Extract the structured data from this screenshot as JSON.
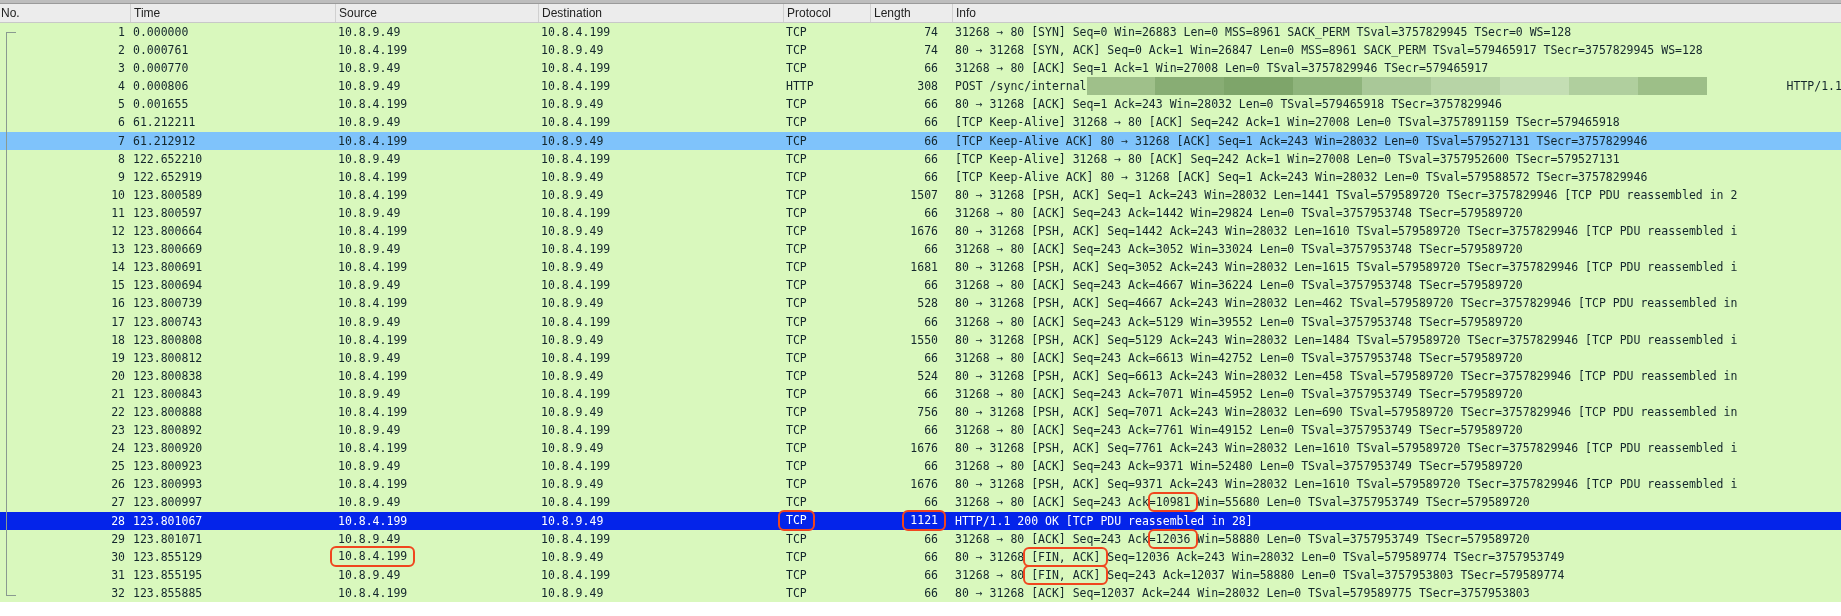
{
  "columns": [
    "No.",
    "Time",
    "Source",
    "Destination",
    "Protocol",
    "Length",
    "Info"
  ],
  "packets": [
    {
      "no": "1",
      "time": "0.000000",
      "source": "10.8.9.49",
      "destination": "10.8.4.199",
      "protocol": "TCP",
      "length": "74",
      "info": "31268 → 80 [SYN] Seq=0 Win=26883 Len=0 MSS=8961 SACK_PERM TSval=3757829945 TSecr=0 WS=128",
      "selected": false,
      "related": false,
      "redacted": false
    },
    {
      "no": "2",
      "time": "0.000761",
      "source": "10.8.4.199",
      "destination": "10.8.9.49",
      "protocol": "TCP",
      "length": "74",
      "info": "80 → 31268 [SYN, ACK] Seq=0 Ack=1 Win=26847 Len=0 MSS=8961 SACK_PERM TSval=579465917 TSecr=3757829945 WS=128",
      "selected": false,
      "related": false,
      "redacted": false
    },
    {
      "no": "3",
      "time": "0.000770",
      "source": "10.8.9.49",
      "destination": "10.8.4.199",
      "protocol": "TCP",
      "length": "66",
      "info": "31268 → 80 [ACK] Seq=1 Ack=1 Win=27008 Len=0 TSval=3757829946 TSecr=579465917",
      "selected": false,
      "related": false,
      "redacted": false
    },
    {
      "no": "4",
      "time": "0.000806",
      "source": "10.8.9.49",
      "destination": "10.8.4.199",
      "protocol": "HTTP",
      "length": "308",
      "info": "POST /sync/internal",
      "info_end": "HTTP/1.1",
      "selected": false,
      "related": false,
      "redacted": true
    },
    {
      "no": "5",
      "time": "0.001655",
      "source": "10.8.4.199",
      "destination": "10.8.9.49",
      "protocol": "TCP",
      "length": "66",
      "info": "80 → 31268 [ACK] Seq=1 Ack=243 Win=28032 Len=0 TSval=579465918 TSecr=3757829946",
      "selected": false,
      "related": false,
      "redacted": false
    },
    {
      "no": "6",
      "time": "61.212211",
      "source": "10.8.9.49",
      "destination": "10.8.4.199",
      "protocol": "TCP",
      "length": "66",
      "info": "[TCP Keep-Alive] 31268 → 80 [ACK] Seq=242 Ack=1 Win=27008 Len=0 TSval=3757891159 TSecr=579465918",
      "selected": false,
      "related": false,
      "redacted": false
    },
    {
      "no": "7",
      "time": "61.212912",
      "source": "10.8.4.199",
      "destination": "10.8.9.49",
      "protocol": "TCP",
      "length": "66",
      "info": "[TCP Keep-Alive ACK] 80 → 31268 [ACK] Seq=1 Ack=243 Win=28032 Len=0 TSval=579527131 TSecr=3757829946",
      "selected": false,
      "related": true,
      "redacted": false
    },
    {
      "no": "8",
      "time": "122.652210",
      "source": "10.8.9.49",
      "destination": "10.8.4.199",
      "protocol": "TCP",
      "length": "66",
      "info": "[TCP Keep-Alive] 31268 → 80 [ACK] Seq=242 Ack=1 Win=27008 Len=0 TSval=3757952600 TSecr=579527131",
      "selected": false,
      "related": false,
      "redacted": false
    },
    {
      "no": "9",
      "time": "122.652919",
      "source": "10.8.4.199",
      "destination": "10.8.9.49",
      "protocol": "TCP",
      "length": "66",
      "info": "[TCP Keep-Alive ACK] 80 → 31268 [ACK] Seq=1 Ack=243 Win=28032 Len=0 TSval=579588572 TSecr=3757829946",
      "selected": false,
      "related": false,
      "redacted": false
    },
    {
      "no": "10",
      "time": "123.800589",
      "source": "10.8.4.199",
      "destination": "10.8.9.49",
      "protocol": "TCP",
      "length": "1507",
      "info": "80 → 31268 [PSH, ACK] Seq=1 Ack=243 Win=28032 Len=1441 TSval=579589720 TSecr=3757829946 [TCP PDU reassembled in 2",
      "selected": false,
      "related": false,
      "redacted": false
    },
    {
      "no": "11",
      "time": "123.800597",
      "source": "10.8.9.49",
      "destination": "10.8.4.199",
      "protocol": "TCP",
      "length": "66",
      "info": "31268 → 80 [ACK] Seq=243 Ack=1442 Win=29824 Len=0 TSval=3757953748 TSecr=579589720",
      "selected": false,
      "related": false,
      "redacted": false
    },
    {
      "no": "12",
      "time": "123.800664",
      "source": "10.8.4.199",
      "destination": "10.8.9.49",
      "protocol": "TCP",
      "length": "1676",
      "info": "80 → 31268 [PSH, ACK] Seq=1442 Ack=243 Win=28032 Len=1610 TSval=579589720 TSecr=3757829946 [TCP PDU reassembled i",
      "selected": false,
      "related": false,
      "redacted": false
    },
    {
      "no": "13",
      "time": "123.800669",
      "source": "10.8.9.49",
      "destination": "10.8.4.199",
      "protocol": "TCP",
      "length": "66",
      "info": "31268 → 80 [ACK] Seq=243 Ack=3052 Win=33024 Len=0 TSval=3757953748 TSecr=579589720",
      "selected": false,
      "related": false,
      "redacted": false
    },
    {
      "no": "14",
      "time": "123.800691",
      "source": "10.8.4.199",
      "destination": "10.8.9.49",
      "protocol": "TCP",
      "length": "1681",
      "info": "80 → 31268 [PSH, ACK] Seq=3052 Ack=243 Win=28032 Len=1615 TSval=579589720 TSecr=3757829946 [TCP PDU reassembled i",
      "selected": false,
      "related": false,
      "redacted": false
    },
    {
      "no": "15",
      "time": "123.800694",
      "source": "10.8.9.49",
      "destination": "10.8.4.199",
      "protocol": "TCP",
      "length": "66",
      "info": "31268 → 80 [ACK] Seq=243 Ack=4667 Win=36224 Len=0 TSval=3757953748 TSecr=579589720",
      "selected": false,
      "related": false,
      "redacted": false
    },
    {
      "no": "16",
      "time": "123.800739",
      "source": "10.8.4.199",
      "destination": "10.8.9.49",
      "protocol": "TCP",
      "length": "528",
      "info": "80 → 31268 [PSH, ACK] Seq=4667 Ack=243 Win=28032 Len=462 TSval=579589720 TSecr=3757829946 [TCP PDU reassembled in",
      "selected": false,
      "related": false,
      "redacted": false
    },
    {
      "no": "17",
      "time": "123.800743",
      "source": "10.8.9.49",
      "destination": "10.8.4.199",
      "protocol": "TCP",
      "length": "66",
      "info": "31268 → 80 [ACK] Seq=243 Ack=5129 Win=39552 Len=0 TSval=3757953748 TSecr=579589720",
      "selected": false,
      "related": false,
      "redacted": false
    },
    {
      "no": "18",
      "time": "123.800808",
      "source": "10.8.4.199",
      "destination": "10.8.9.49",
      "protocol": "TCP",
      "length": "1550",
      "info": "80 → 31268 [PSH, ACK] Seq=5129 Ack=243 Win=28032 Len=1484 TSval=579589720 TSecr=3757829946 [TCP PDU reassembled i",
      "selected": false,
      "related": false,
      "redacted": false
    },
    {
      "no": "19",
      "time": "123.800812",
      "source": "10.8.9.49",
      "destination": "10.8.4.199",
      "protocol": "TCP",
      "length": "66",
      "info": "31268 → 80 [ACK] Seq=243 Ack=6613 Win=42752 Len=0 TSval=3757953748 TSecr=579589720",
      "selected": false,
      "related": false,
      "redacted": false
    },
    {
      "no": "20",
      "time": "123.800838",
      "source": "10.8.4.199",
      "destination": "10.8.9.49",
      "protocol": "TCP",
      "length": "524",
      "info": "80 → 31268 [PSH, ACK] Seq=6613 Ack=243 Win=28032 Len=458 TSval=579589720 TSecr=3757829946 [TCP PDU reassembled in",
      "selected": false,
      "related": false,
      "redacted": false
    },
    {
      "no": "21",
      "time": "123.800843",
      "source": "10.8.9.49",
      "destination": "10.8.4.199",
      "protocol": "TCP",
      "length": "66",
      "info": "31268 → 80 [ACK] Seq=243 Ack=7071 Win=45952 Len=0 TSval=3757953749 TSecr=579589720",
      "selected": false,
      "related": false,
      "redacted": false
    },
    {
      "no": "22",
      "time": "123.800888",
      "source": "10.8.4.199",
      "destination": "10.8.9.49",
      "protocol": "TCP",
      "length": "756",
      "info": "80 → 31268 [PSH, ACK] Seq=7071 Ack=243 Win=28032 Len=690 TSval=579589720 TSecr=3757829946 [TCP PDU reassembled in",
      "selected": false,
      "related": false,
      "redacted": false
    },
    {
      "no": "23",
      "time": "123.800892",
      "source": "10.8.9.49",
      "destination": "10.8.4.199",
      "protocol": "TCP",
      "length": "66",
      "info": "31268 → 80 [ACK] Seq=243 Ack=7761 Win=49152 Len=0 TSval=3757953749 TSecr=579589720",
      "selected": false,
      "related": false,
      "redacted": false
    },
    {
      "no": "24",
      "time": "123.800920",
      "source": "10.8.4.199",
      "destination": "10.8.9.49",
      "protocol": "TCP",
      "length": "1676",
      "info": "80 → 31268 [PSH, ACK] Seq=7761 Ack=243 Win=28032 Len=1610 TSval=579589720 TSecr=3757829946 [TCP PDU reassembled i",
      "selected": false,
      "related": false,
      "redacted": false
    },
    {
      "no": "25",
      "time": "123.800923",
      "source": "10.8.9.49",
      "destination": "10.8.4.199",
      "protocol": "TCP",
      "length": "66",
      "info": "31268 → 80 [ACK] Seq=243 Ack=9371 Win=52480 Len=0 TSval=3757953749 TSecr=579589720",
      "selected": false,
      "related": false,
      "redacted": false
    },
    {
      "no": "26",
      "time": "123.800993",
      "source": "10.8.4.199",
      "destination": "10.8.9.49",
      "protocol": "TCP",
      "length": "1676",
      "info": "80 → 31268 [PSH, ACK] Seq=9371 Ack=243 Win=28032 Len=1610 TSval=579589720 TSecr=3757829946 [TCP PDU reassembled i",
      "selected": false,
      "related": false,
      "redacted": false
    },
    {
      "no": "27",
      "time": "123.800997",
      "source": "10.8.9.49",
      "destination": "10.8.4.199",
      "protocol": "TCP",
      "length": "66",
      "info": [
        {
          "text": "31268 → 80 [ACK] Seq=243 Ack=",
          "circled": false
        },
        {
          "text": "10981",
          "circled": true
        },
        {
          "text": " Win=55680 Len=0 TSval=3757953749 TSecr=579589720",
          "circled": false
        }
      ],
      "selected": false,
      "related": false,
      "redacted": false
    },
    {
      "no": "28",
      "time": "123.801067",
      "source": "10.8.4.199",
      "destination": "10.8.9.49",
      "protocol": "TCP",
      "length": "1121",
      "info": "HTTP/1.1 200 OK  [TCP PDU reassembled in 28]",
      "circled": {
        "protocol": true,
        "length": true
      },
      "selected": true,
      "related": false,
      "redacted": false
    },
    {
      "no": "29",
      "time": "123.801071",
      "source": "10.8.9.49",
      "destination": "10.8.4.199",
      "protocol": "TCP",
      "length": "66",
      "info": [
        {
          "text": "31268 → 80 [ACK] Seq=243 Ack=",
          "circled": false
        },
        {
          "text": "12036",
          "circled": true
        },
        {
          "text": " Win=58880 Len=0 TSval=3757953749 TSecr=579589720",
          "circled": false
        }
      ],
      "selected": false,
      "related": false,
      "redacted": false
    },
    {
      "no": "30",
      "time": "123.855129",
      "source": "10.8.4.199",
      "destination": "10.8.9.49",
      "protocol": "TCP",
      "length": "66",
      "info": [
        {
          "text": "80 → 31268 ",
          "circled": false
        },
        {
          "text": "[FIN, ACK]",
          "circled": true
        },
        {
          "text": " Seq=12036 Ack=243 Win=28032 Len=0 TSval=579589774 TSecr=3757953749",
          "circled": false
        }
      ],
      "circled": {
        "source": true
      },
      "selected": false,
      "related": false,
      "redacted": false
    },
    {
      "no": "31",
      "time": "123.855195",
      "source": "10.8.9.49",
      "destination": "10.8.4.199",
      "protocol": "TCP",
      "length": "66",
      "info": [
        {
          "text": "31268 → 80 ",
          "circled": false
        },
        {
          "text": "[FIN, ACK]",
          "circled": true
        },
        {
          "text": " Seq=243 Ack=12037 Win=58880 Len=0 TSval=3757953803 TSecr=579589774",
          "circled": false
        }
      ],
      "selected": false,
      "related": false,
      "redacted": false
    },
    {
      "no": "32",
      "time": "123.855885",
      "source": "10.8.4.199",
      "destination": "10.8.9.49",
      "protocol": "TCP",
      "length": "66",
      "info": "80 → 31268 [ACK] Seq=12037 Ack=244 Win=28032 Len=0 TSval=579589775 TSecr=3757953803",
      "selected": false,
      "related": false,
      "redacted": false
    }
  ]
}
